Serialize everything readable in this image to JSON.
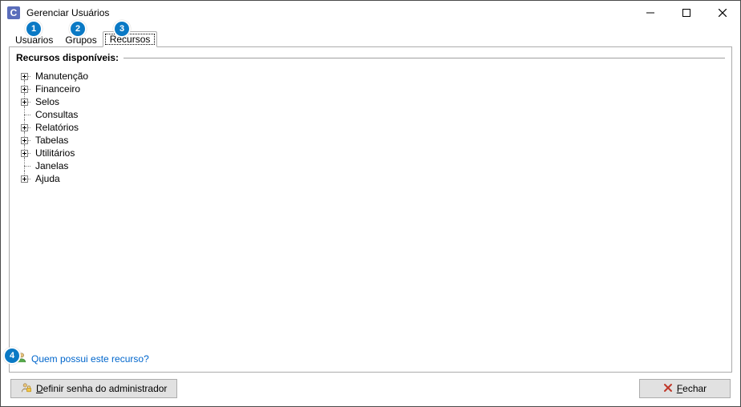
{
  "window": {
    "title": "Gerenciar Usuários",
    "app_icon_letter": "C"
  },
  "tabs": {
    "tab1": "Usuários",
    "tab2": "Grupos",
    "tab3": "Recursos"
  },
  "panel": {
    "header": "Recursos disponíveis:"
  },
  "tree": {
    "items": [
      {
        "label": "Manutenção",
        "expandable": true
      },
      {
        "label": "Financeiro",
        "expandable": true
      },
      {
        "label": "Selos",
        "expandable": true
      },
      {
        "label": "Consultas",
        "expandable": false
      },
      {
        "label": "Relatórios",
        "expandable": true
      },
      {
        "label": "Tabelas",
        "expandable": true
      },
      {
        "label": "Utilitários",
        "expandable": true
      },
      {
        "label": "Janelas",
        "expandable": false
      },
      {
        "label": "Ajuda",
        "expandable": true
      }
    ]
  },
  "link": {
    "label": "Quem possui este recurso?"
  },
  "buttons": {
    "admin_pw_prefix": "D",
    "admin_pw_rest": "efinir senha do administrador",
    "close_prefix": "F",
    "close_rest": "echar"
  },
  "callouts": {
    "c1": "1",
    "c2": "2",
    "c3": "3",
    "c4": "4"
  }
}
